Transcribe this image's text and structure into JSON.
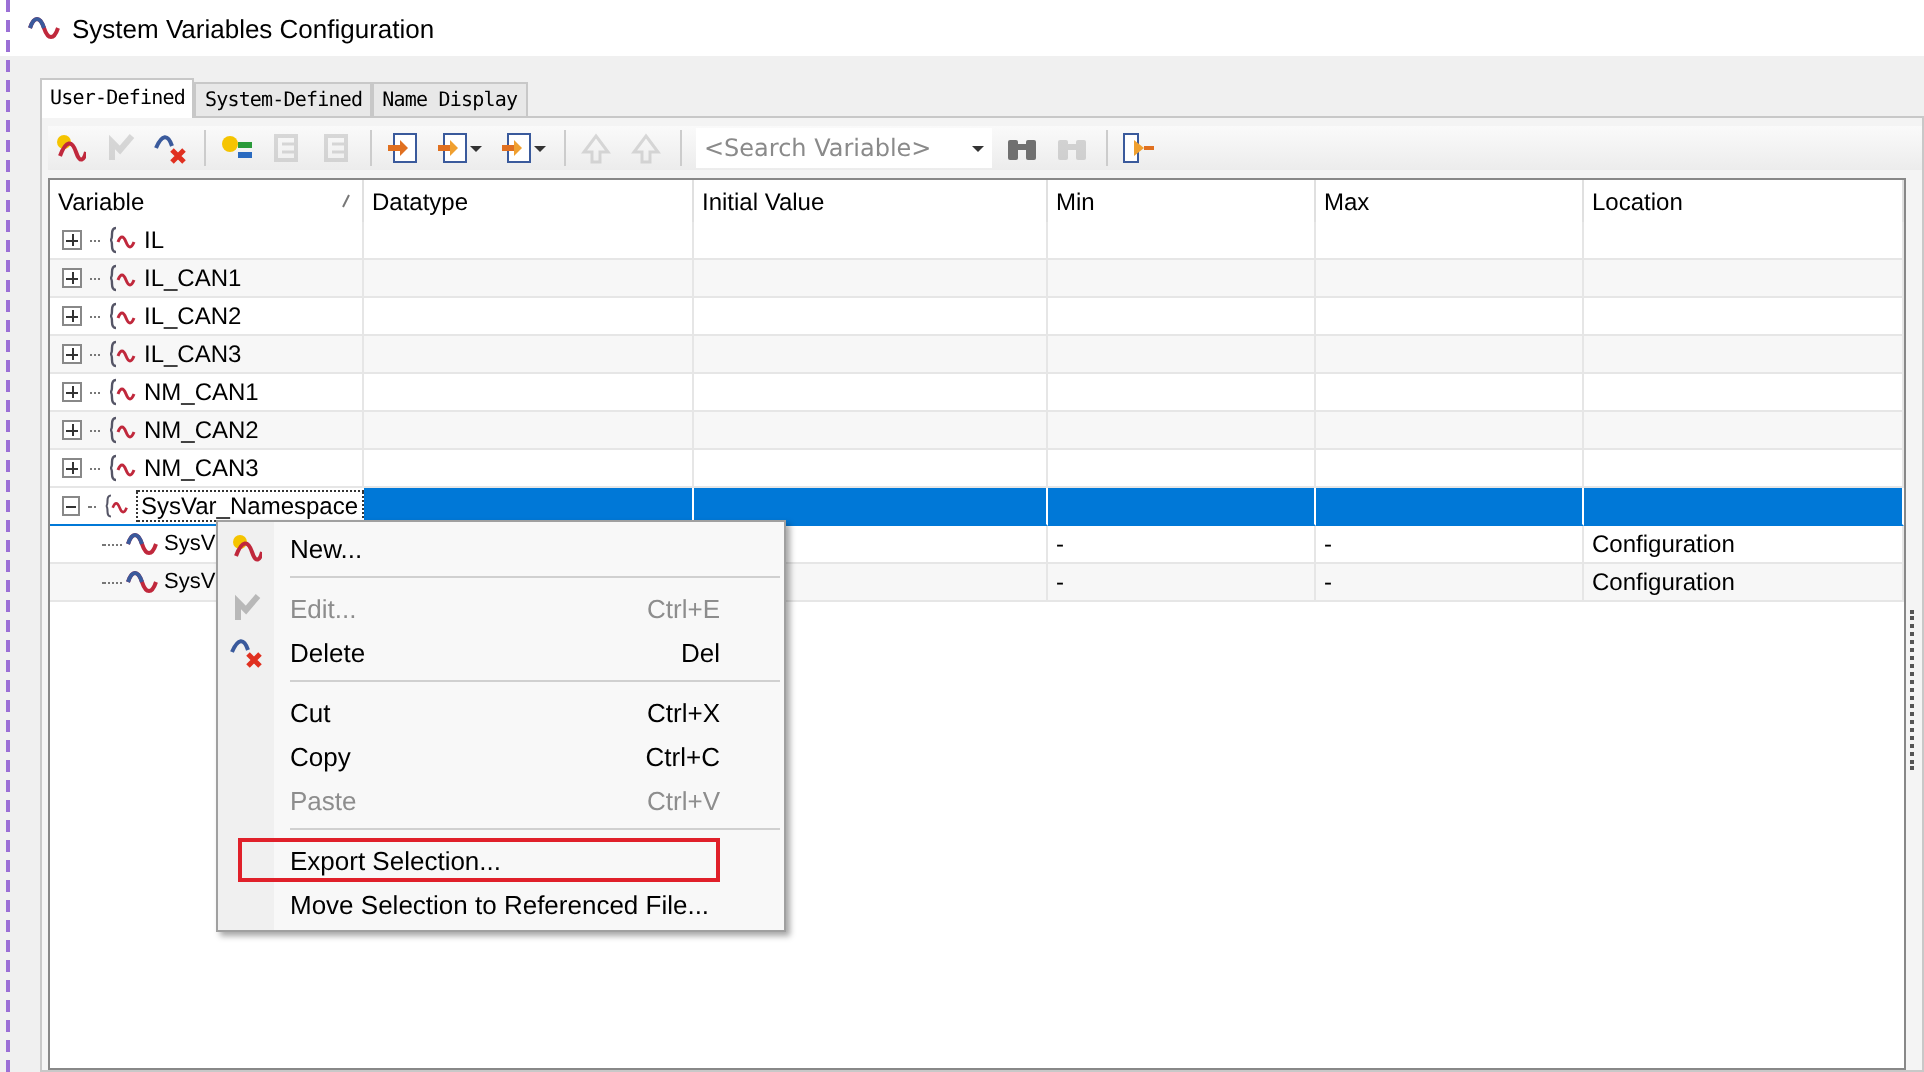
{
  "window": {
    "title": "System Variables Configuration"
  },
  "tabs": [
    {
      "label": "User-Defined",
      "selected": true
    },
    {
      "label": "System-Defined",
      "selected": false
    },
    {
      "label": "Name Display",
      "selected": false
    }
  ],
  "toolbar": {
    "buttons": [
      {
        "disabled": false
      },
      {
        "disabled": true
      },
      {
        "disabled": false
      },
      {
        "disabled": false
      },
      {
        "disabled": true
      },
      {
        "disabled": true
      },
      {
        "disabled": false
      },
      {
        "disabled": false
      },
      {
        "disabled": false
      },
      {
        "disabled": true
      },
      {
        "disabled": true
      }
    ],
    "search": {
      "placeholder": "<Search Variable>"
    },
    "find_buttons": [
      {
        "disabled": false
      },
      {
        "disabled": true
      },
      {
        "disabled": false
      }
    ]
  },
  "table": {
    "columns": [
      "Variable",
      "Datatype",
      "Initial Value",
      "Min",
      "Max",
      "Location"
    ],
    "rows": [
      {
        "variable": "IL",
        "expanded": false,
        "selected": false
      },
      {
        "variable": "IL_CAN1",
        "expanded": false,
        "selected": false
      },
      {
        "variable": "IL_CAN2",
        "expanded": false,
        "selected": false
      },
      {
        "variable": "IL_CAN3",
        "expanded": false,
        "selected": false
      },
      {
        "variable": "NM_CAN1",
        "expanded": false,
        "selected": false
      },
      {
        "variable": "NM_CAN2",
        "expanded": false,
        "selected": false
      },
      {
        "variable": "NM_CAN3",
        "expanded": false,
        "selected": false
      },
      {
        "variable": "SysVar_Namespace",
        "expanded": true,
        "selected": true,
        "children": [
          {
            "variable": "SysV",
            "min": "-",
            "max": "-",
            "location": "Configuration",
            "selected": false
          },
          {
            "variable": "SysV",
            "min": "-",
            "max": "-",
            "location": "Configuration",
            "selected": false
          }
        ]
      }
    ]
  },
  "context_menu": {
    "items": [
      {
        "kind": "item",
        "label": "New...",
        "disabled": false,
        "highlighted": false
      },
      {
        "kind": "separator"
      },
      {
        "kind": "item",
        "label": "Edit...",
        "shortcut": "Ctrl+E",
        "disabled": true,
        "highlighted": false
      },
      {
        "kind": "item",
        "label": "Delete",
        "shortcut": "Del",
        "disabled": false,
        "highlighted": false
      },
      {
        "kind": "separator"
      },
      {
        "kind": "item",
        "label": "Cut",
        "shortcut": "Ctrl+X",
        "disabled": false,
        "highlighted": false
      },
      {
        "kind": "item",
        "label": "Copy",
        "shortcut": "Ctrl+C",
        "disabled": false,
        "highlighted": false
      },
      {
        "kind": "item",
        "label": "Paste",
        "shortcut": "Ctrl+V",
        "disabled": true,
        "highlighted": false
      },
      {
        "kind": "separator"
      },
      {
        "kind": "item",
        "label": "Export Selection...",
        "disabled": false,
        "highlighted": true
      },
      {
        "kind": "item",
        "label": "Move Selection to Referenced File...",
        "disabled": false,
        "highlighted": false
      }
    ]
  }
}
